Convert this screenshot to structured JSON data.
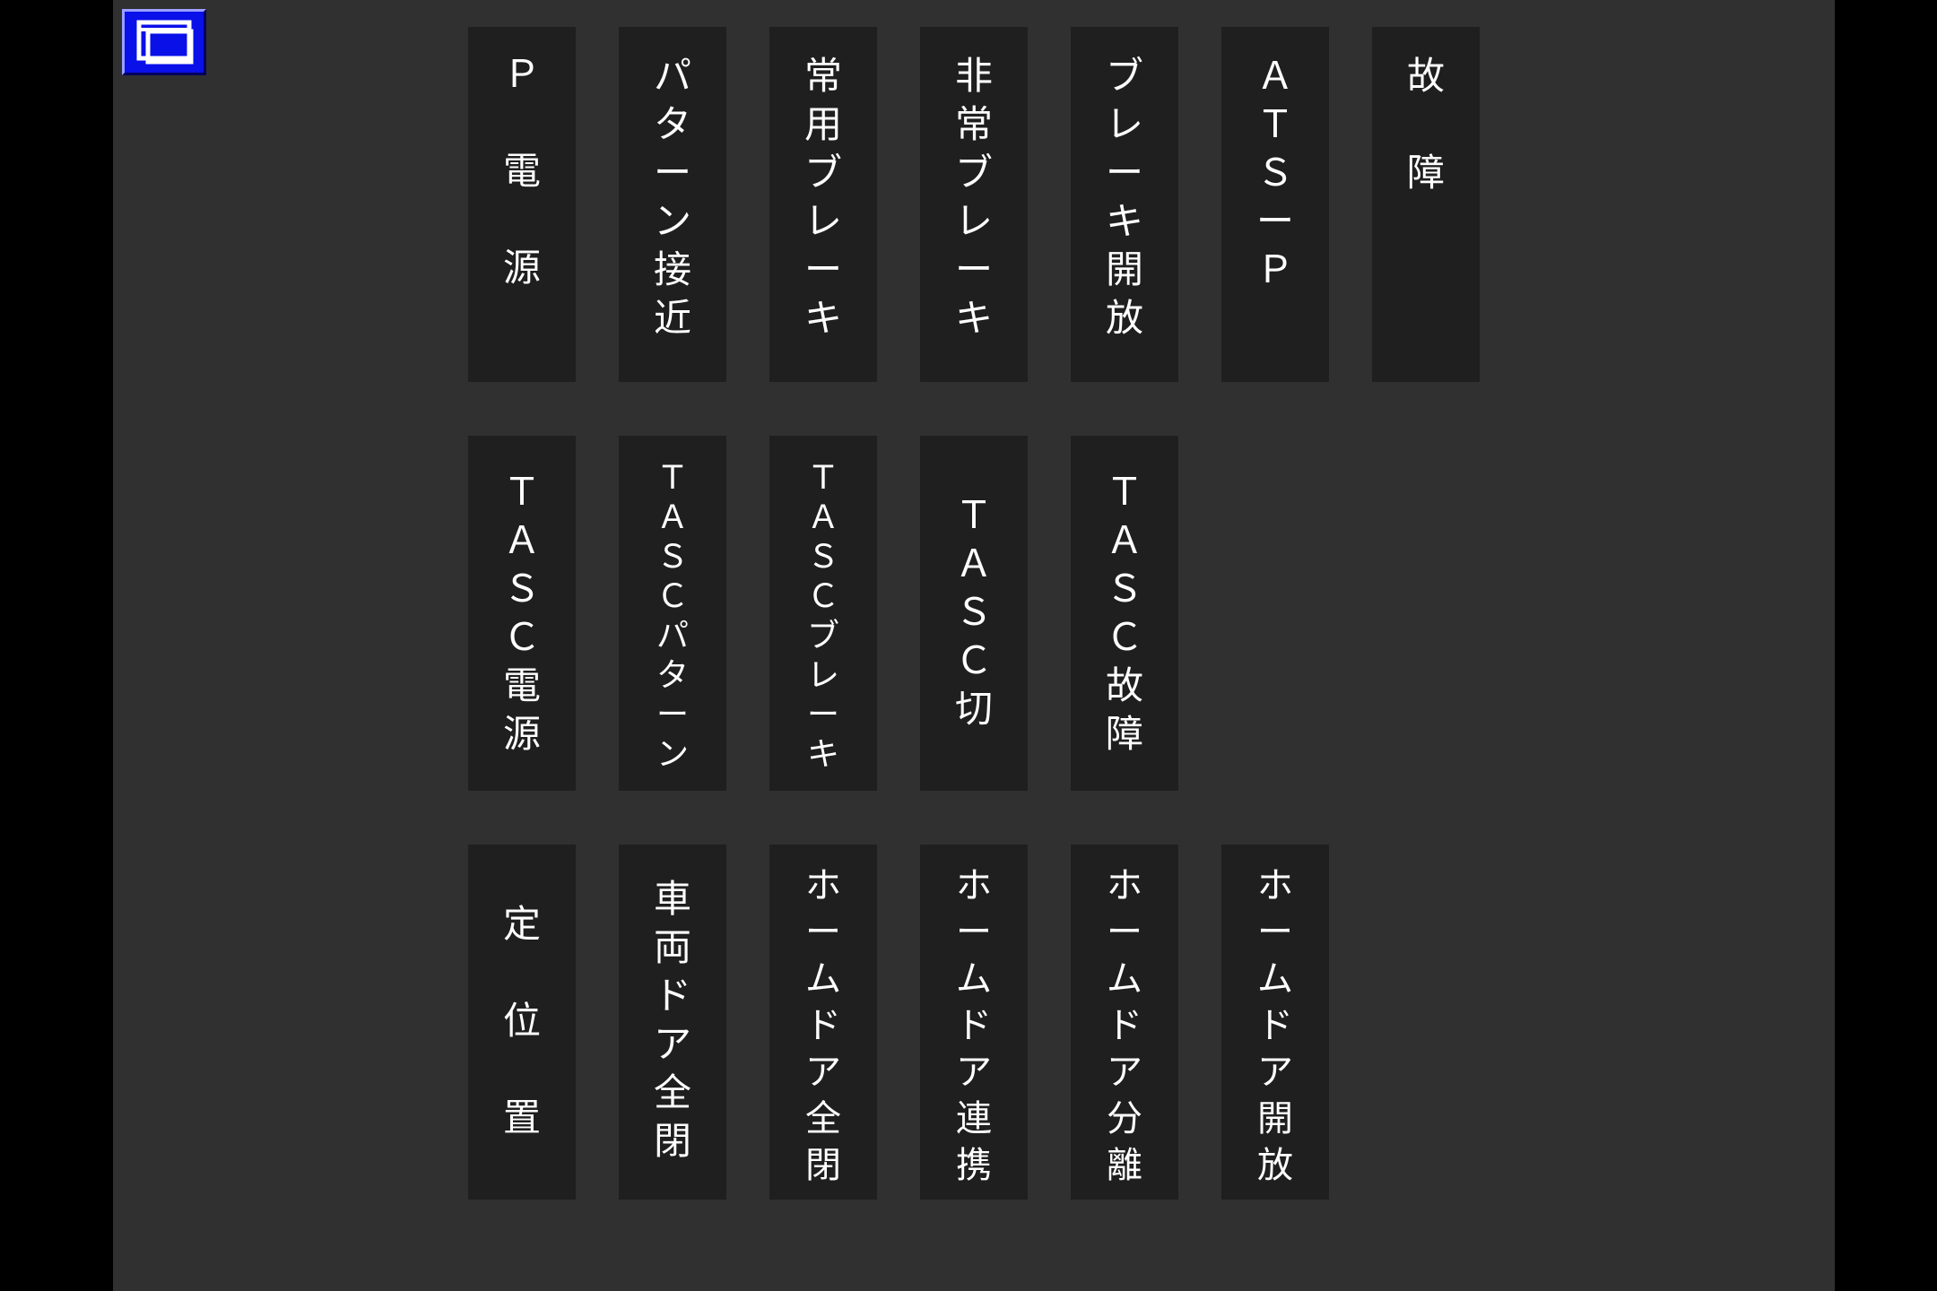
{
  "window_button": {
    "icon": "window-restore-icon",
    "color": "#0a10e8"
  },
  "rows": [
    {
      "lamps": [
        {
          "id": "p-power",
          "label": "Ｐ\n\n電\n\n源"
        },
        {
          "id": "pattern-approach",
          "label": "パ\nタ\nー\nン\n接\n近"
        },
        {
          "id": "service-brake",
          "label": "常\n用\nブ\nレ\nー\nキ"
        },
        {
          "id": "emergency-brake",
          "label": "非\n常\nブ\nレ\nー\nキ"
        },
        {
          "id": "brake-release",
          "label": "ブ\nレ\nー\nキ\n開\n放"
        },
        {
          "id": "ats-p",
          "label": "Ａ\nＴ\nＳ\nー\nＰ"
        },
        {
          "id": "fault",
          "label": "故\n\n障"
        }
      ]
    },
    {
      "lamps": [
        {
          "id": "tasc-power",
          "label": "Ｔ\nＡ\nＳ\nＣ\n電\n源"
        },
        {
          "id": "tasc-pattern",
          "label": "Ｔ\nＡ\nＳ\nＣ\nパ\nタ\nー\nン"
        },
        {
          "id": "tasc-brake",
          "label": "Ｔ\nＡ\nＳ\nＣ\nブ\nレ\nー\nキ"
        },
        {
          "id": "tasc-off",
          "label": "Ｔ\nＡ\nＳ\nＣ\n切"
        },
        {
          "id": "tasc-fault",
          "label": "Ｔ\nＡ\nＳ\nＣ\n故\n障"
        }
      ]
    },
    {
      "lamps": [
        {
          "id": "fixed-position",
          "label": "定\n\n位\n\n置"
        },
        {
          "id": "car-door-closed",
          "label": "車\n両\nド\nア\n全\n閉"
        },
        {
          "id": "platform-door-closed",
          "label": "ホ\nー\nム\nド\nア\n全\n閉"
        },
        {
          "id": "platform-door-linked",
          "label": "ホ\nー\nム\nド\nア\n連\n携"
        },
        {
          "id": "platform-door-separated",
          "label": "ホ\nー\nム\nド\nア\n分\n離"
        },
        {
          "id": "platform-door-open",
          "label": "ホ\nー\nム\nド\nア\n開\n放"
        }
      ]
    }
  ]
}
